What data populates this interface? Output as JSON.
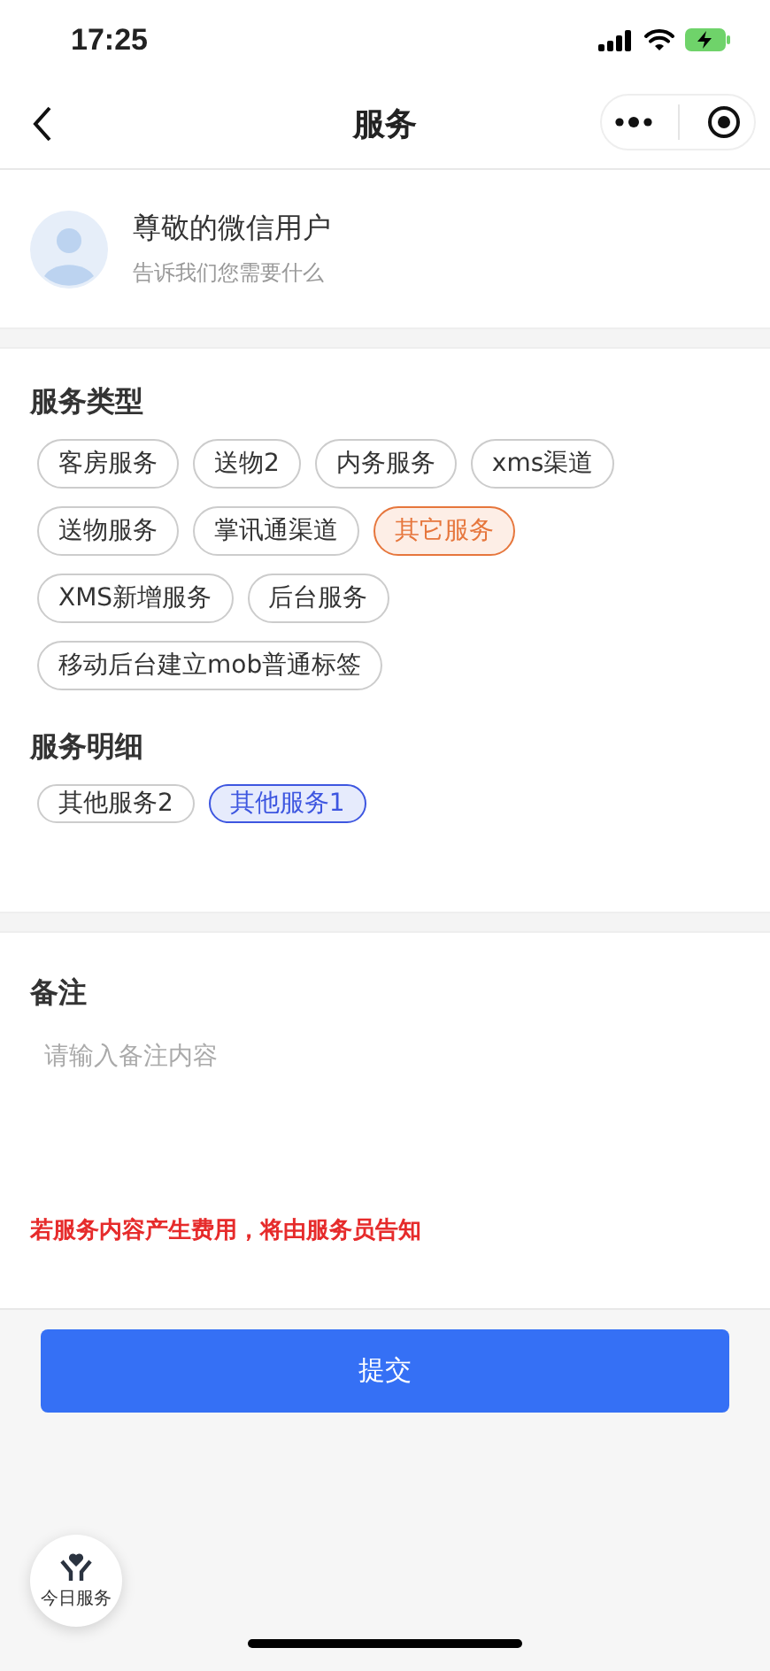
{
  "status_bar": {
    "time": "17:25"
  },
  "nav": {
    "title": "服务"
  },
  "user": {
    "name": "尊敬的微信用户",
    "subtitle": "告诉我们您需要什么"
  },
  "groups": [
    {
      "kind": "type",
      "title": "服务类型",
      "tags": [
        {
          "label": "客房服务",
          "selected": false
        },
        {
          "label": "送物2",
          "selected": false
        },
        {
          "label": "内务服务",
          "selected": false
        },
        {
          "label": "xms渠道",
          "selected": false
        },
        {
          "label": "送物服务",
          "selected": false
        },
        {
          "label": "掌讯通渠道",
          "selected": false
        },
        {
          "label": "其它服务",
          "selected": true
        },
        {
          "label": "XMS新增服务",
          "selected": false
        },
        {
          "label": "后台服务",
          "selected": false
        },
        {
          "label": "移动后台建立mob普通标签",
          "selected": false
        }
      ]
    },
    {
      "kind": "detail",
      "title": "服务明细",
      "tags": [
        {
          "label": "其他服务2",
          "selected": false
        },
        {
          "label": "其他服务1",
          "selected": true
        }
      ]
    }
  ],
  "note": {
    "title": "备注",
    "placeholder": "请输入备注内容",
    "warning": "若服务内容产生费用，将由服务员告知"
  },
  "submit": "提交",
  "float_button": {
    "label": "今日服务"
  }
}
